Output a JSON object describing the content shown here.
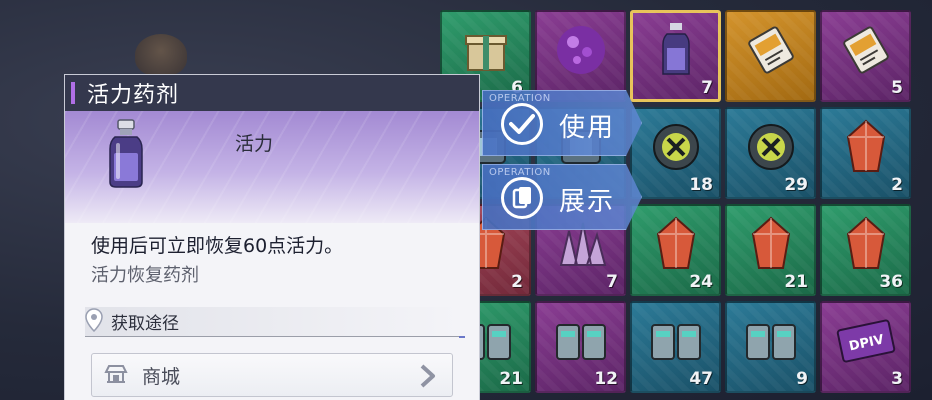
{
  "item": {
    "name": "活力药剂",
    "category": "活力",
    "description": "使用后可立即恢复60点活力。",
    "subtitle": "活力恢复药剂"
  },
  "source": {
    "heading": "获取途径",
    "shop_label": "商城"
  },
  "actions": {
    "operation_tag": "OPERATION",
    "use_label": "使用",
    "show_label": "展示"
  },
  "inventory": [
    {
      "count": "6",
      "rarity": "green",
      "icon": "gift-box-icon"
    },
    {
      "count": "",
      "rarity": "purple",
      "icon": "purple-orb-icon"
    },
    {
      "count": "7",
      "rarity": "purple",
      "icon": "potion-bottle-icon",
      "selected": true
    },
    {
      "count": "",
      "rarity": "orange",
      "icon": "ticket-card-icon"
    },
    {
      "count": "5",
      "rarity": "purple",
      "icon": "ticket-card-icon"
    },
    {
      "count": "",
      "rarity": "blue",
      "icon": "chip-icon"
    },
    {
      "count": "",
      "rarity": "blue",
      "icon": "chip-icon"
    },
    {
      "count": "18",
      "rarity": "blue",
      "icon": "gear-core-icon"
    },
    {
      "count": "29",
      "rarity": "blue",
      "icon": "gear-core-icon"
    },
    {
      "count": "2",
      "rarity": "blue",
      "icon": "crystal-icon"
    },
    {
      "count": "2",
      "rarity": "red",
      "icon": "crystal-icon"
    },
    {
      "count": "7",
      "rarity": "purple",
      "icon": "crystal-cluster-icon"
    },
    {
      "count": "24",
      "rarity": "green",
      "icon": "crystal-icon"
    },
    {
      "count": "21",
      "rarity": "green",
      "icon": "crystal-icon"
    },
    {
      "count": "36",
      "rarity": "green",
      "icon": "crystal-icon"
    },
    {
      "count": "21",
      "rarity": "green",
      "icon": "battery-pack-icon"
    },
    {
      "count": "12",
      "rarity": "purple",
      "icon": "battery-pack-icon"
    },
    {
      "count": "47",
      "rarity": "blue",
      "icon": "battery-pack-icon"
    },
    {
      "count": "9",
      "rarity": "blue",
      "icon": "battery-pack-icon"
    },
    {
      "count": "3",
      "rarity": "purple",
      "icon": "dpiv-card-icon",
      "label": "DPIV"
    }
  ],
  "colors": {
    "accent_purple": "#b06fe6",
    "action_blue": "#5a82cf",
    "selected_gold": "#e8c45a"
  }
}
